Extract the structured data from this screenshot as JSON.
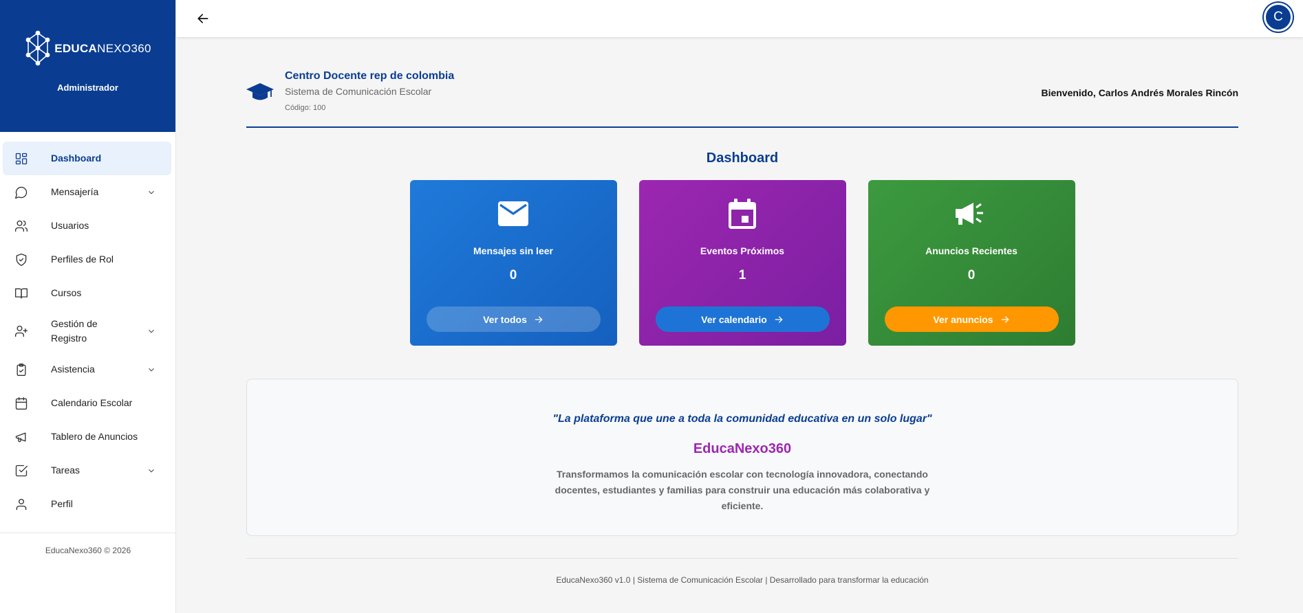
{
  "brand": {
    "logo_bold": "EDUCA",
    "logo_light": "NEXO",
    "logo_num": "360",
    "role": "Administrador"
  },
  "sidebar": {
    "items": [
      {
        "label": "Dashboard",
        "icon": "dashboard-grid-icon",
        "active": true,
        "expandable": false
      },
      {
        "label": "Mensajería",
        "icon": "message-bubble-icon",
        "active": false,
        "expandable": true
      },
      {
        "label": "Usuarios",
        "icon": "users-icon",
        "active": false,
        "expandable": false
      },
      {
        "label": "Perfiles de Rol",
        "icon": "shield-check-icon",
        "active": false,
        "expandable": false
      },
      {
        "label": "Cursos",
        "icon": "book-open-icon",
        "active": false,
        "expandable": false
      },
      {
        "label": "Gestión de Registro",
        "icon": "user-plus-icon",
        "active": false,
        "expandable": true
      },
      {
        "label": "Asistencia",
        "icon": "clipboard-check-icon",
        "active": false,
        "expandable": true
      },
      {
        "label": "Calendario Escolar",
        "icon": "calendar-icon",
        "active": false,
        "expandable": false
      },
      {
        "label": "Tablero de Anuncios",
        "icon": "megaphone-icon",
        "active": false,
        "expandable": false
      },
      {
        "label": "Tareas",
        "icon": "checkbox-icon",
        "active": false,
        "expandable": true
      },
      {
        "label": "Perfil",
        "icon": "user-icon",
        "active": false,
        "expandable": false
      }
    ],
    "copyright": "EducaNexo360 © 2026"
  },
  "topbar": {
    "avatar_letter": "C"
  },
  "school": {
    "name": "Centro Docente rep de colombia",
    "subtitle": "Sistema de Comunicación Escolar",
    "code": "Código: 100",
    "welcome": "Bienvenido, Carlos Andrés Morales Rincón"
  },
  "page_title": "Dashboard",
  "cards": [
    {
      "title": "Mensajes sin leer",
      "value": "0",
      "button": "Ver todos",
      "icon": "envelope-icon",
      "color": "#1f7ad9"
    },
    {
      "title": "Eventos Próximos",
      "value": "1",
      "button": "Ver calendario",
      "icon": "calendar-event-icon",
      "color": "#9c27b0"
    },
    {
      "title": "Anuncios Recientes",
      "value": "0",
      "button": "Ver anuncios",
      "icon": "megaphone-icon",
      "color": "#2e7d32"
    }
  ],
  "promo": {
    "slogan": "\"La plataforma que une a toda la comunidad educativa en un solo lugar\"",
    "brand_name": "EducaNexo360",
    "description": "Transformamos la comunicación escolar con tecnología innovadora, conectando docentes, estudiantes y familias para construir una educación más colaborativa y eficiente."
  },
  "footer": {
    "text": "EducaNexo360 v1.0 | Sistema de Comunicación Escolar | Desarrollado para transformar la educación"
  },
  "colors": {
    "primary": "#0a3d91",
    "accent_purple": "#9c27b0",
    "accent_orange": "#ff9800"
  }
}
